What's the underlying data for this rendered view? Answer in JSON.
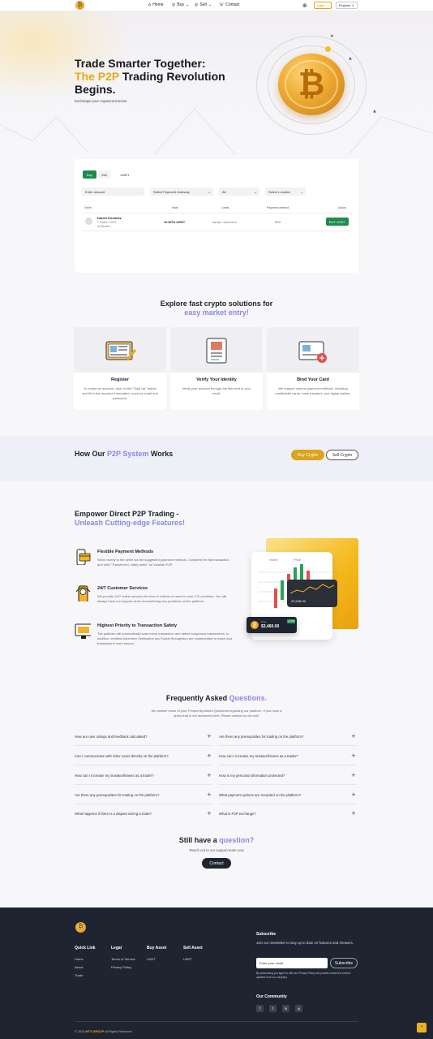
{
  "nav": {
    "links": [
      {
        "label": "Home",
        "icon": "home-icon"
      },
      {
        "label": "Buy",
        "icon": "buy-icon"
      },
      {
        "label": "Sell",
        "icon": "sell-icon"
      },
      {
        "label": "Contact",
        "icon": "contact-icon"
      }
    ],
    "login_label": "Login",
    "register_label": "Register"
  },
  "hero": {
    "title_line1": "Trade Smarter Together:",
    "title_accent": "The P2P",
    "title_line2_rest": " Trading Revolution",
    "title_line3": "Begins.",
    "subtitle": "Exchange your cryptocurrencies"
  },
  "trade": {
    "tabs": [
      "Buy",
      "Sell"
    ],
    "asset": "USDT",
    "amount_placeholder": "Enter amount",
    "gateway_label": "Select Payment Gateway",
    "filter_all": "All",
    "location_label": "Select Location",
    "columns": [
      "Seller",
      "Rate",
      "Limits",
      "Payment method",
      "Action"
    ],
    "rows": [
      {
        "seller": "Daniel Kominkz",
        "seller_meta1": "1 Trades / 100%",
        "seller_meta2": "(0) Months",
        "rate": "10 MTU USDT",
        "limits": "000.000 - 000.00 MTU",
        "payment": "MTU",
        "action": "BUY USDT"
      }
    ]
  },
  "explore": {
    "title_line1": "Explore fast crypto solutions for",
    "title_line2": "easy market entry!",
    "cards": [
      {
        "title": "Register",
        "desc": "To create an account, click on the \"Sign Up\" button and fill in the required information, such as email and password."
      },
      {
        "title": "Verify Your Identity",
        "desc": "Verify your account through the link sent to your email."
      },
      {
        "title": "Bind Your Card",
        "desc": "We support various payment methods, including credit/debit cards, bank transfers, and digital wallets."
      }
    ]
  },
  "how": {
    "title_pre": "How Our ",
    "title_accent": "P2P System",
    "title_post": " Works",
    "buy_label": "Buy Crypto",
    "sell_label": "Sell Crypto"
  },
  "empower": {
    "title_line1": "Empower Direct P2P Trading -",
    "title_line2": "Unleash Cutting-edge Features!",
    "items": [
      {
        "title": "Flexible Payment Methods",
        "desc": "Send money to the seller via the suggested payment methods. Complete the fiat transaction and click \"Transferred, notify seller\" on Vouelah P2P."
      },
      {
        "title": "24/7 Customer Services",
        "desc": "We provide 24/7 online services for tens of millions of users in over 170 countries. You will always have our support when encountering any problems on the platform."
      },
      {
        "title": "Highest Priority to Transaction Safety",
        "desc": "The platform will automatically scan every transaction and detect suspicious transactions. In addition, certified Advertiser Verification and Facial Recognition are implemented to make your transactions more secure."
      }
    ],
    "mock": {
      "nav_item": "Home",
      "menu_label": "Price",
      "chart_value": "22,226.00",
      "wallet_label": "Price",
      "wallet_value": "$3,460.00",
      "wallet_badge": "+2.5%"
    }
  },
  "faq": {
    "title_pre": "Frequently Asked ",
    "title_accent": "Questions.",
    "intro_line1": "We answer some of your Frequently Asked Questions regarding our platform. If you have a",
    "intro_line2": "query that is not answered here, Please contact us via mail.",
    "left": [
      "How are user ratings and feedback calculated?",
      "Can I communicate with other users directly on the platform?",
      "How can I increase my trustworthiness as a trader?",
      "Are there any prerequisites for trading on the platform?",
      "What happens if there is a dispute during a trade?"
    ],
    "right": [
      "Are there any prerequisites for trading on the platform?",
      "How can I increase my trustworthiness as a trader?",
      "How is my personal information protected?",
      "What payment options are accepted on the platform?",
      "What is P2P exchange?"
    ]
  },
  "support": {
    "title_pre": "Still have a ",
    "title_accent": "question?",
    "subtitle": "Reach out to our support team now",
    "button": "Contact"
  },
  "footer": {
    "quick_link": {
      "heading": "Quick Link",
      "items": [
        "Home",
        "About",
        "Trade"
      ]
    },
    "legal": {
      "heading": "Legal",
      "items": [
        "Terms of Service",
        "Privacy Policy"
      ]
    },
    "buy_asset": {
      "heading": "Buy Asset",
      "items": [
        "USDT"
      ]
    },
    "sell_asset": {
      "heading": "Sell Asset",
      "items": [
        "USDT"
      ]
    },
    "subscribe": {
      "heading": "Subscribe",
      "desc": "Join our newsletter to stay up to date on features and releases.",
      "placeholder": "Enter your email",
      "button": "Subscribe",
      "note": "By subscribing you agree to with our Privacy Policy and provide consent to receive updates from our company."
    },
    "community": {
      "heading": "Our Community",
      "icons": [
        "facebook-icon",
        "twitter-icon",
        "linkedin-icon",
        "instagram-icon"
      ]
    },
    "copyright_pre": "© 2024 ",
    "copyright_brand": "MTY-GROUP",
    "copyright_post": " All Rights Reserved"
  },
  "colors": {
    "accent": "#e9a81b",
    "purple": "#8b85e8",
    "green": "#1e8b4c",
    "dark": "#1e2530"
  }
}
